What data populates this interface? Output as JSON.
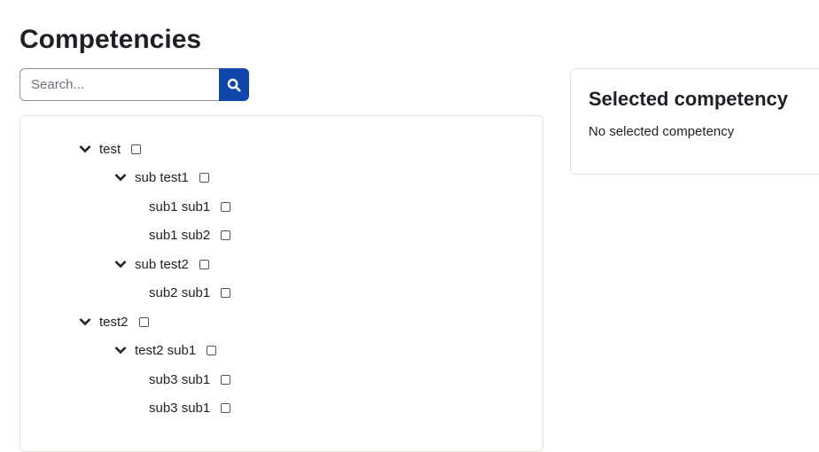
{
  "page": {
    "title": "Competencies"
  },
  "search": {
    "placeholder": "Search...",
    "button_icon": "search-icon"
  },
  "tree": {
    "nodes": [
      {
        "label": "test",
        "expandable": true,
        "checked": false
      },
      {
        "label": "sub test1",
        "expandable": true,
        "checked": false
      },
      {
        "label": "sub1 sub1",
        "expandable": false,
        "checked": false
      },
      {
        "label": "sub1 sub2",
        "expandable": false,
        "checked": false
      },
      {
        "label": "sub test2",
        "expandable": true,
        "checked": false
      },
      {
        "label": "sub2 sub1",
        "expandable": false,
        "checked": false
      },
      {
        "label": "test2",
        "expandable": true,
        "checked": false
      },
      {
        "label": "test2 sub1",
        "expandable": true,
        "checked": false
      },
      {
        "label": "sub3 sub1",
        "expandable": false,
        "checked": false
      },
      {
        "label": "sub3 sub1",
        "expandable": false,
        "checked": false
      }
    ]
  },
  "selected": {
    "title": "Selected competency",
    "empty_text": "No selected competency"
  },
  "colors": {
    "accent": "#0f47ad",
    "text": "#1d2125",
    "border": "#dee2e6"
  }
}
